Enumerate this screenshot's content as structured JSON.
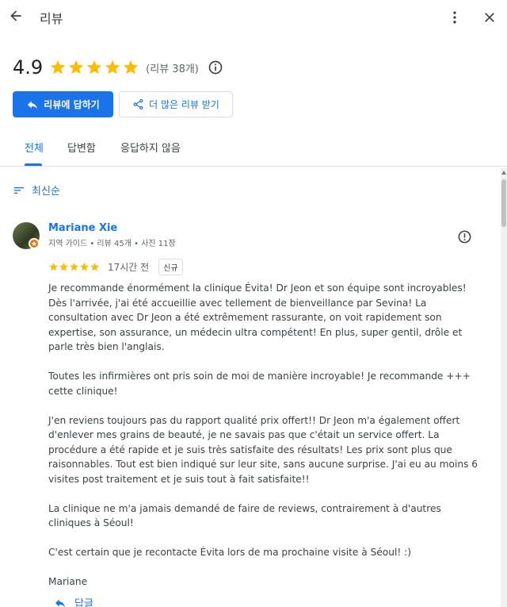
{
  "header": {
    "title": "리뷰"
  },
  "summary": {
    "score": "4.9",
    "stars": 5,
    "count_label": "(리뷰 38개)"
  },
  "actions": {
    "reply_label": "리뷰에 답하기",
    "more_reviews_label": "더 많은 리뷰 받기"
  },
  "tabs": [
    {
      "label": "전체",
      "active": true
    },
    {
      "label": "답변함",
      "active": false
    },
    {
      "label": "응답하지 않음",
      "active": false
    }
  ],
  "sort": {
    "label": "최신순"
  },
  "review": {
    "name": "Mariane Xie",
    "meta": "지역 가이드 • 리뷰 45개 • 사진 11장",
    "stars": 5,
    "time": "17시간 전",
    "badge": "신규",
    "paragraphs": [
      "Je recommande énormément la clinique Évita! Dr Jeon et son équipe sont incroyables! Dès l'arrivée, j'ai été accueillie avec tellement de bienveillance par Sevina! La consultation avec Dr Jeon a été extrêmement rassurante, on voit rapidement son expertise, son assurance, un médecin ultra compétent! En plus, super gentil, drôle et parle très bien l'anglais.",
      "Toutes les infirmières ont pris soin de moi de manière incroyable! Je recommande +++ cette clinique!",
      "J'en reviens toujours pas du rapport qualité prix offert!! Dr Jeon m'a également offert d'enlever mes grains de beauté, je ne savais pas que c'était un service offert. La procédure a été rapide et je suis très satisfaite des résultats! Les prix sont plus que raisonnables. Tout est bien indiqué sur leur site, sans aucune surprise. J'ai eu au moins 6 visites post traitement et je suis tout à fait satisfaite!!",
      "La clinique ne m'a jamais demandé de faire de reviews, contrairement à d'autres cliniques à Séoul!",
      "C'est certain que je recontacte Évita lors de ma prochaine visite à Séoul! :)",
      "Mariane"
    ],
    "reply_label": "답글"
  },
  "colors": {
    "accent": "#1a73e8",
    "star": "#fbbc04",
    "badge": "#e8710a"
  },
  "icons": [
    "arrow-left-icon",
    "more-vert-icon",
    "close-icon",
    "info-icon",
    "reply-icon",
    "share-icon",
    "sort-icon",
    "flag-icon",
    "star-icon"
  ]
}
